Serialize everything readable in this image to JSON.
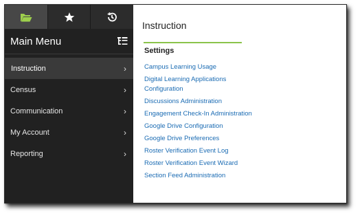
{
  "sidebar": {
    "tabs": [
      {
        "icon": "folder-icon"
      },
      {
        "icon": "star-icon"
      },
      {
        "icon": "history-icon"
      }
    ],
    "menu_title": "Main Menu",
    "menu_toggle_icon": "list-tree-icon",
    "items": [
      {
        "label": "Instruction",
        "active": true
      },
      {
        "label": "Census"
      },
      {
        "label": "Communication"
      },
      {
        "label": "My Account"
      },
      {
        "label": "Reporting"
      }
    ],
    "chevron": "›"
  },
  "main": {
    "title": "Instruction",
    "section_title": "Settings",
    "links": [
      "Campus Learning Usage",
      "Digital Learning Applications Configuration",
      "Discussions Administration",
      "Engagement Check-In Administration",
      "Google Drive Configuration",
      "Google Drive Preferences",
      "Roster Verification Event Log",
      "Roster Verification Event Wizard",
      "Section Feed Administration"
    ]
  },
  "colors": {
    "sidebar_bg": "#212121",
    "active_tab_icon": "#9ed04d",
    "accent_rule": "#8bc34a",
    "link": "#1a6bb3"
  }
}
